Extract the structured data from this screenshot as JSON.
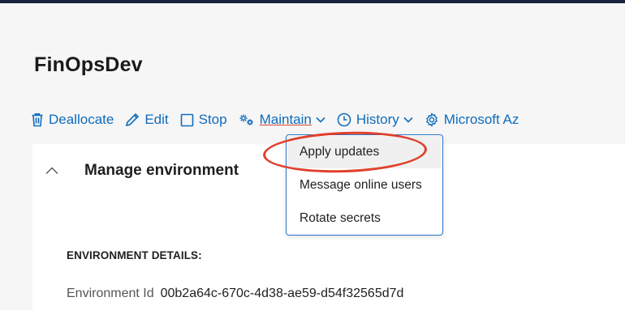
{
  "page": {
    "title": "FinOpsDev"
  },
  "toolbar": {
    "deallocate": "Deallocate",
    "edit": "Edit",
    "stop": "Stop",
    "maintain": "Maintain",
    "history": "History",
    "microsoft": "Microsoft Az"
  },
  "section": {
    "title": "Manage environment",
    "details_heading": "ENVIRONMENT DETAILS:",
    "env_id_label": "Environment Id",
    "env_id_value": "00b2a64c-670c-4d38-ae59-d54f32565d7d"
  },
  "maintain_menu": {
    "items": [
      "Apply updates",
      "Message online users",
      "Rotate secrets"
    ],
    "hovered": "Apply updates"
  },
  "colors": {
    "accent": "#0f6cbd",
    "annotation": "#e0402c",
    "menu_border": "#2b76c9",
    "top_bar": "#16233a"
  },
  "icons": [
    "trash-icon",
    "pencil-icon",
    "stop-square-icon",
    "gears-icon",
    "chevron-down-icon",
    "clock-icon",
    "gear-icon",
    "chevron-up-icon"
  ]
}
